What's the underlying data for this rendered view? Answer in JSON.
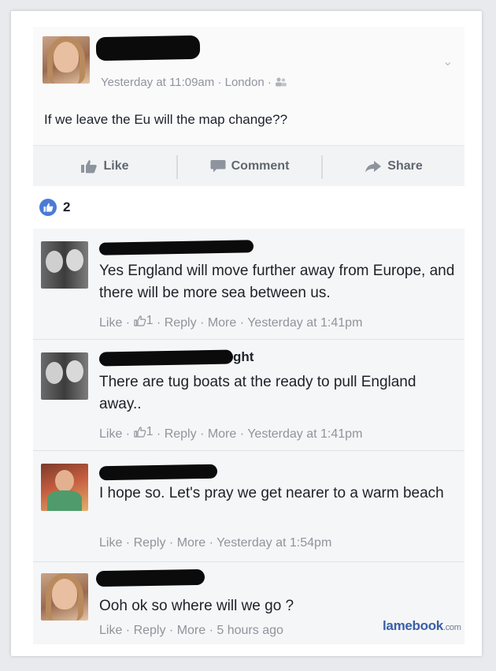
{
  "post": {
    "timestamp": "Yesterday at 11:09am",
    "location": "London",
    "audience_icon": "friends-icon",
    "text": "If we leave the Eu will the map change??"
  },
  "actions": {
    "like": "Like",
    "comment": "Comment",
    "share": "Share"
  },
  "reactions": {
    "count": "2",
    "icon": "thumbs-up-icon"
  },
  "comments": [
    {
      "name_suffix": "",
      "text": "Yes England will move further away from Europe, and there will be more sea between us.",
      "like_label": "Like",
      "like_count": "1",
      "reply_label": "Reply",
      "more_label": "More",
      "time": "Yesterday at 1:41pm"
    },
    {
      "name_suffix": "ght",
      "text": "There are tug boats at the ready to pull England away..",
      "like_label": "Like",
      "like_count": "1",
      "reply_label": "Reply",
      "more_label": "More",
      "time": "Yesterday at 1:41pm"
    },
    {
      "name_suffix": "",
      "text": "I hope so. Let's pray we get nearer to a warm beach",
      "like_label": "Like",
      "reply_label": "Reply",
      "more_label": "More",
      "time": "Yesterday at 1:54pm"
    },
    {
      "name_suffix": "",
      "text": "Ooh ok so where will we go ?",
      "like_label": "Like",
      "reply_label": "Reply",
      "more_label": "More",
      "time": "5 hours ago"
    }
  ],
  "watermark": {
    "brand": "lamebook",
    "tld": ".com"
  },
  "colors": {
    "like_blue": "#4a7bd6",
    "meta_gray": "#90949c",
    "text_dark": "#1d2129",
    "watermark_blue": "#3a5fa6"
  }
}
